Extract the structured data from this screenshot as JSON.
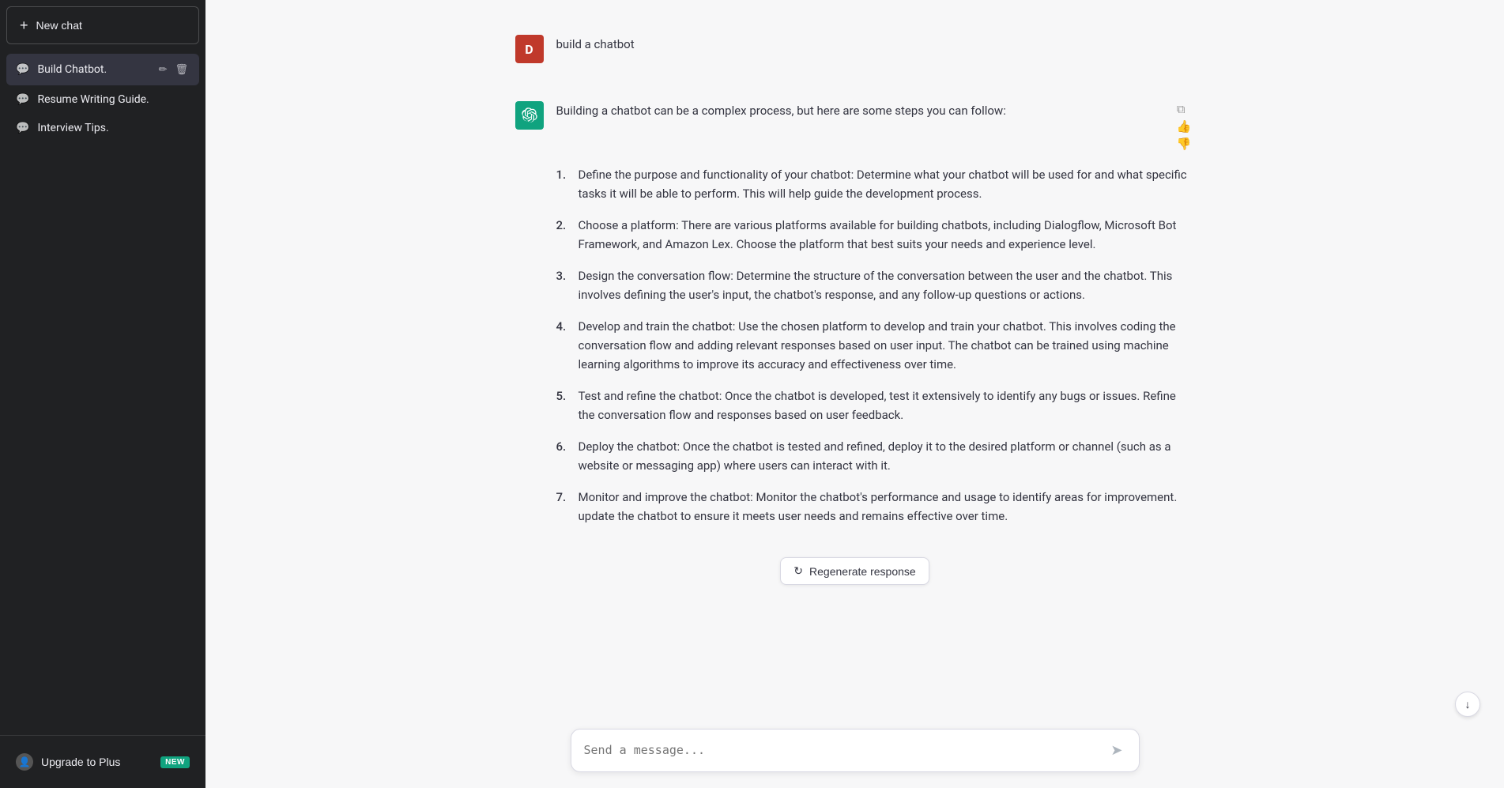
{
  "sidebar": {
    "new_chat_label": "New chat",
    "items": [
      {
        "id": "build-chatbot",
        "label": "Build Chatbot.",
        "active": true
      },
      {
        "id": "resume-writing",
        "label": "Resume Writing Guide.",
        "active": false
      },
      {
        "id": "interview-tips",
        "label": "Interview Tips.",
        "active": false
      }
    ],
    "upgrade_label": "Upgrade to Plus",
    "upgrade_badge": "NEW"
  },
  "chat": {
    "user_message": "build a chatbot",
    "user_avatar_letter": "D",
    "assistant_intro": "Building a chatbot can be a complex process, but here are some steps you can follow:",
    "steps": [
      {
        "num": "1.",
        "text": "Define the purpose and functionality of your chatbot: Determine what your chatbot will be used for and what specific tasks it will be able to perform. This will help guide the development process."
      },
      {
        "num": "2.",
        "text": "Choose a platform: There are various platforms available for building chatbots, including Dialogflow, Microsoft Bot Framework, and Amazon Lex. Choose the platform that best suits your needs and experience level."
      },
      {
        "num": "3.",
        "text": "Design the conversation flow: Determine the structure of the conversation between the user and the chatbot. This involves defining the user's input, the chatbot's response, and any follow-up questions or actions."
      },
      {
        "num": "4.",
        "text": "Develop and train the chatbot: Use the chosen platform to develop and train your chatbot. This involves coding the conversation flow and adding relevant responses based on user input. The chatbot can be trained using machine learning algorithms to improve its accuracy and effectiveness over time."
      },
      {
        "num": "5.",
        "text": "Test and refine the chatbot: Once the chatbot is developed, test it extensively to identify any bugs or issues. Refine the conversation flow and responses based on user feedback."
      },
      {
        "num": "6.",
        "text": "Deploy the chatbot: Once the chatbot is tested and refined, deploy it to the desired platform or channel (such as a website or messaging app) where users can interact with it."
      },
      {
        "num": "7.",
        "text": "Monitor and improve the chatbot: Monitor the chatbot's performance and usage to identify areas for improvement. update the chatbot to ensure it meets user needs and remains effective over time."
      }
    ]
  },
  "input": {
    "placeholder": "Send a message..."
  },
  "regenerate": {
    "label": "Regenerate response"
  },
  "icons": {
    "plus": "+",
    "chat": "💬",
    "edit": "✏",
    "trash": "🗑",
    "copy": "⧉",
    "thumbup": "👍",
    "thumbdown": "👎",
    "send": "➤",
    "regenerate": "↻",
    "user": "👤",
    "scrolldown": "↓"
  }
}
